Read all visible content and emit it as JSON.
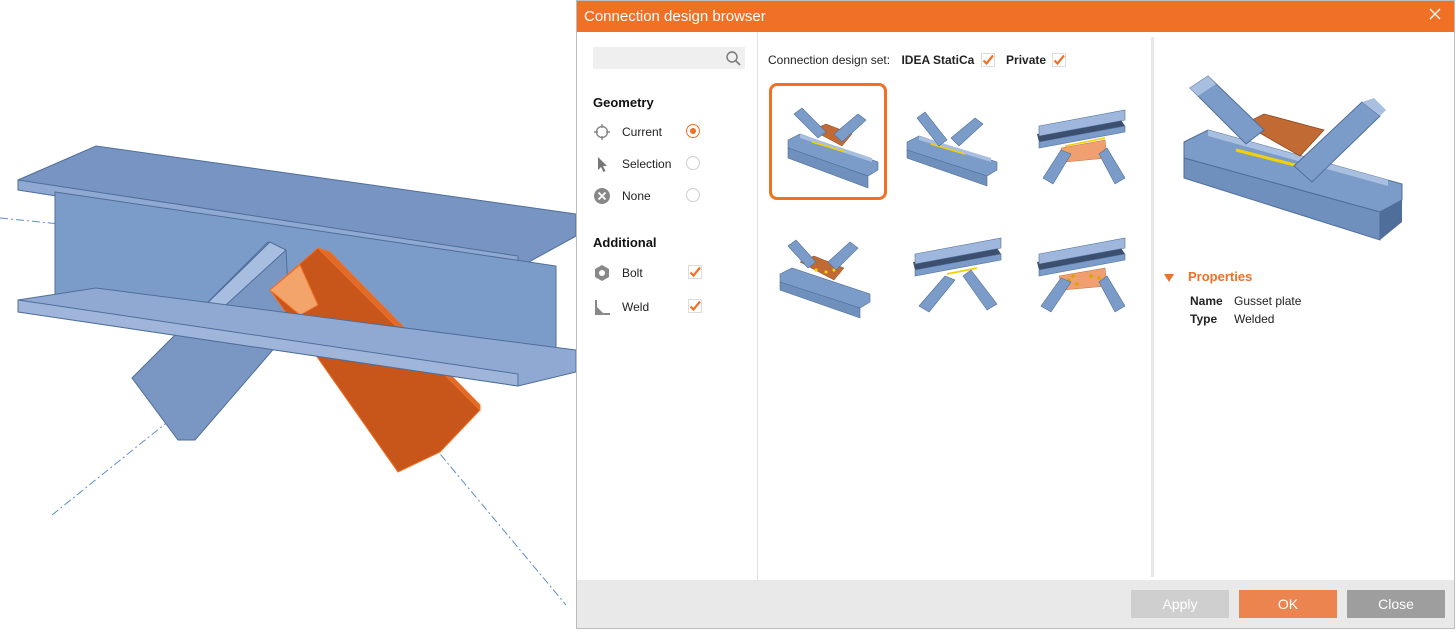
{
  "colors": {
    "accent": "#f07026",
    "steel": "#7b9cc9",
    "member_selected": "#c8561a",
    "plate": "#f0a070",
    "weld": "#f5d000"
  },
  "dialog": {
    "title": "Connection design browser",
    "search": {
      "placeholder": "",
      "icon": "search-icon"
    },
    "geometry": {
      "title": "Geometry",
      "options": [
        {
          "label": "Current",
          "icon": "crosshair-icon",
          "selected": true
        },
        {
          "label": "Selection",
          "icon": "cursor-arrow-icon",
          "selected": false
        },
        {
          "label": "None",
          "icon": "x-circle-icon",
          "selected": false
        }
      ]
    },
    "additional": {
      "title": "Additional",
      "options": [
        {
          "label": "Bolt",
          "icon": "bolt-nut-icon",
          "checked": true
        },
        {
          "label": "Weld",
          "icon": "weld-icon",
          "checked": true
        }
      ]
    },
    "design_set": {
      "label": "Connection design set:",
      "sets": [
        {
          "name": "IDEA StatiCa",
          "checked": true
        },
        {
          "name": "Private",
          "checked": true
        }
      ]
    },
    "templates": {
      "count": 6,
      "selected_index": 0
    },
    "properties": {
      "title": "Properties",
      "rows": [
        {
          "key": "Name",
          "value": "Gusset plate"
        },
        {
          "key": "Type",
          "value": "Welded"
        }
      ]
    },
    "buttons": {
      "apply": "Apply",
      "ok": "OK",
      "close": "Close"
    }
  }
}
